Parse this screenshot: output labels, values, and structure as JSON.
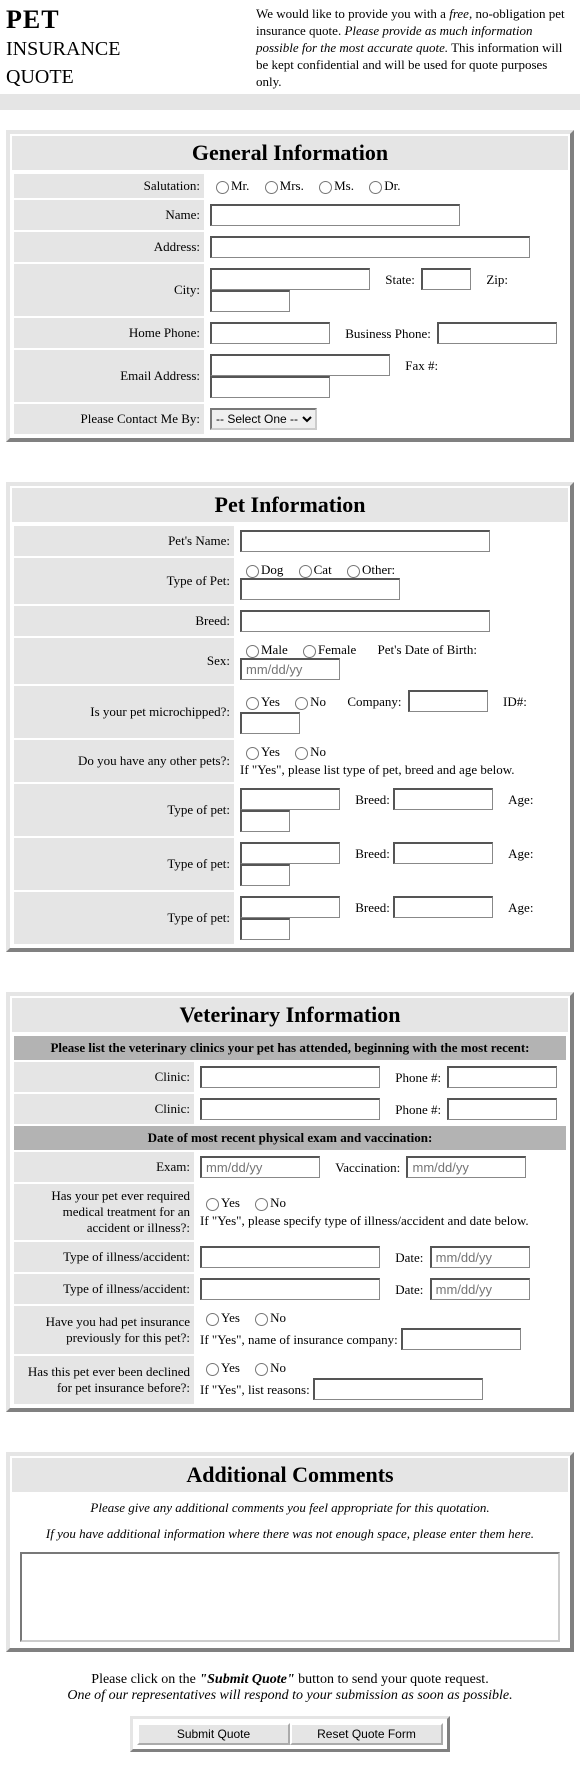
{
  "header": {
    "title_l1": "PET",
    "title_l2": "INSURANCE",
    "title_l3": "QUOTE",
    "intro_1": "We would like to provide you with a ",
    "intro_free": "free",
    "intro_2": ", no-obligation pet insurance quote. ",
    "intro_italic": "Please provide as much information possible for the most accurate quote.",
    "intro_3": " This information will be kept confidential and will be used for quote purposes only."
  },
  "general": {
    "title": "General Information",
    "salutation_lbl": "Salutation:",
    "sal_mr": "Mr.",
    "sal_mrs": "Mrs.",
    "sal_ms": "Ms.",
    "sal_dr": "Dr.",
    "name_lbl": "Name:",
    "address_lbl": "Address:",
    "city_lbl": "City:",
    "state_lbl": "State:",
    "zip_lbl": "Zip:",
    "home_phone_lbl": "Home Phone:",
    "business_phone_lbl": "Business Phone:",
    "email_lbl": "Email Address:",
    "fax_lbl": "Fax #:",
    "contact_lbl": "Please Contact Me By:",
    "select_one": "-- Select One --"
  },
  "pet": {
    "title": "Pet Information",
    "name_lbl": "Pet's Name:",
    "type_lbl": "Type of Pet:",
    "dog": "Dog",
    "cat": "Cat",
    "other": "Other:",
    "breed_lbl": "Breed:",
    "sex_lbl": "Sex:",
    "male": "Male",
    "female": "Female",
    "dob_lbl": "Pet's Date of Birth:",
    "dob_ph": "mm/dd/yy",
    "micro_lbl": "Is your pet microchipped?:",
    "yes": "Yes",
    "no": "No",
    "company_lbl": "Company:",
    "id_lbl": "ID#:",
    "other_pets_lbl": "Do you have any other pets?:",
    "other_pets_note": "If \"Yes\", please list type of pet, breed and age below.",
    "type_of_pet_lbl": "Type of pet:",
    "breed_sub_lbl": "Breed:",
    "age_lbl": "Age:"
  },
  "vet": {
    "title": "Veterinary Information",
    "clinics_head": "Please list the veterinary clinics your pet has attended, beginning with the most recent:",
    "clinic_lbl": "Clinic:",
    "phone_lbl": "Phone #:",
    "recent_head": "Date of most recent physical exam and vaccination:",
    "exam_lbl": "Exam:",
    "vacc_lbl": "Vaccination:",
    "date_ph": "mm/dd/yy",
    "med_lbl": "Has your pet ever required medical treatment for an accident or illness?:",
    "med_note": "If \"Yes\", please specify type of illness/accident and date below.",
    "illness_lbl": "Type of illness/accident:",
    "date_lbl": "Date:",
    "prev_ins_lbl": "Have you had pet insurance previously for this pet?:",
    "prev_ins_note": "If \"Yes\", name of insurance company:",
    "declined_lbl": "Has this pet ever been declined for pet insurance before?:",
    "declined_note": "If \"Yes\", list reasons:"
  },
  "comments": {
    "title": "Additional Comments",
    "line1": "Please give any additional comments you feel appropriate for this quotation.",
    "line2": "If you have additional information where there was not enough space, please enter them here."
  },
  "footer": {
    "line1a": "Please click on the ",
    "line1b": "\"Submit Quote\"",
    "line1c": " button to send your quote request.",
    "line2": "One of our representatives will respond to your submission as soon as possible.",
    "submit": "Submit Quote",
    "reset": "Reset Quote Form"
  }
}
